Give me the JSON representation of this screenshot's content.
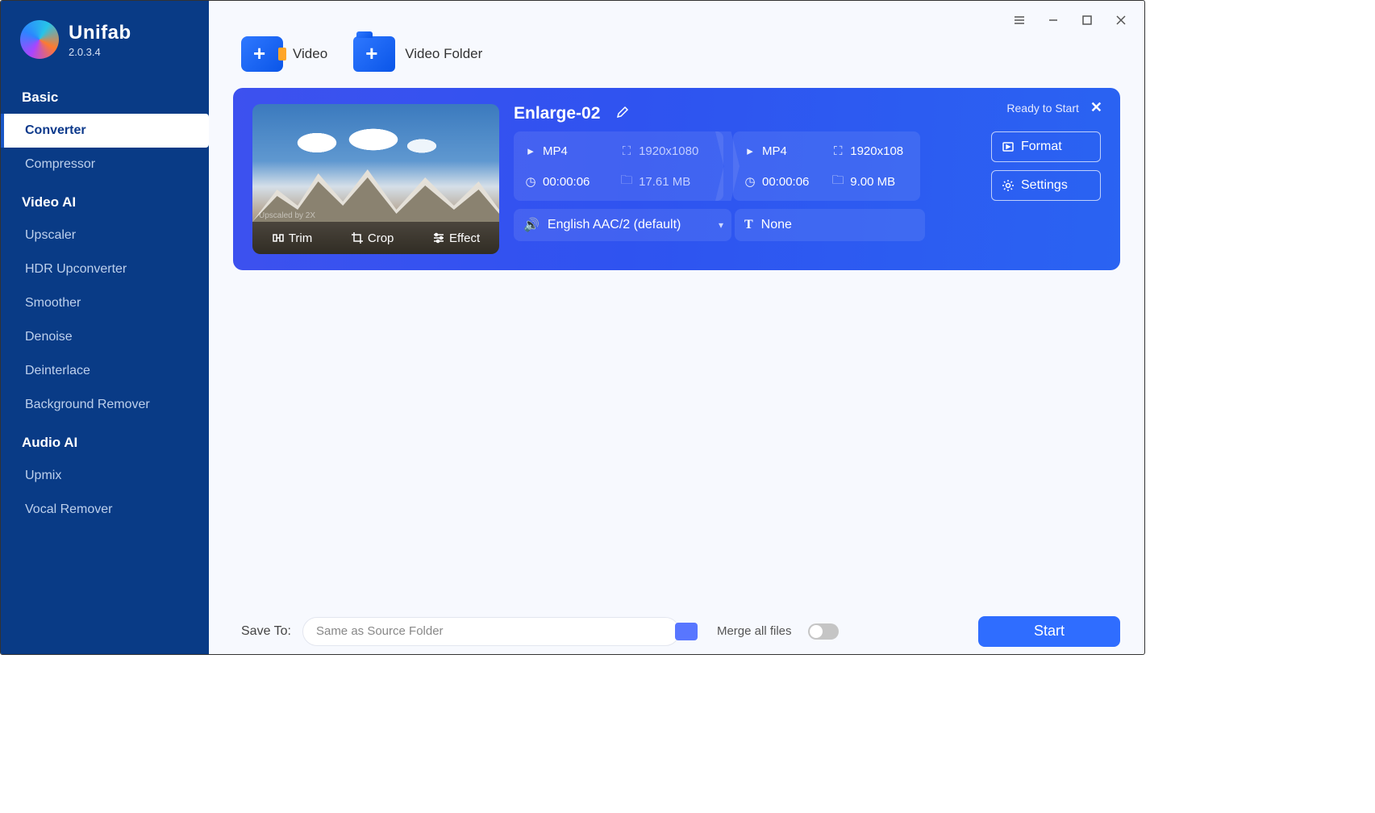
{
  "brand": {
    "name": "Unifab",
    "version": "2.0.3.4"
  },
  "sidebar": {
    "sections": [
      {
        "title": "Basic",
        "items": [
          {
            "label": "Converter",
            "active": true
          },
          {
            "label": "Compressor",
            "active": false
          }
        ]
      },
      {
        "title": "Video AI",
        "items": [
          {
            "label": "Upscaler"
          },
          {
            "label": "HDR Upconverter"
          },
          {
            "label": "Smoother"
          },
          {
            "label": "Denoise"
          },
          {
            "label": "Deinterlace"
          },
          {
            "label": "Background Remover"
          }
        ]
      },
      {
        "title": "Audio AI",
        "items": [
          {
            "label": "Upmix"
          },
          {
            "label": "Vocal Remover"
          }
        ]
      }
    ]
  },
  "toolbar": {
    "add_video": "Video",
    "add_folder": "Video Folder"
  },
  "task": {
    "status": "Ready to Start",
    "filename": "Enlarge-02",
    "thumb_watermark": "Upscaled by 2X",
    "tools": {
      "trim": "Trim",
      "crop": "Crop",
      "effect": "Effect"
    },
    "source": {
      "format": "MP4",
      "resolution": "1920x1080",
      "duration": "00:00:06",
      "size": "17.61 MB"
    },
    "target": {
      "format": "MP4",
      "resolution": "1920x108",
      "duration": "00:00:06",
      "size": "9.00 MB"
    },
    "buttons": {
      "format": "Format",
      "settings": "Settings"
    },
    "audio": "English AAC/2 (default)",
    "subtitle": "None"
  },
  "footer": {
    "save_label": "Save To:",
    "save_path": "Same as Source Folder",
    "merge_label": "Merge all files",
    "merge_on": false,
    "start_label": "Start"
  }
}
